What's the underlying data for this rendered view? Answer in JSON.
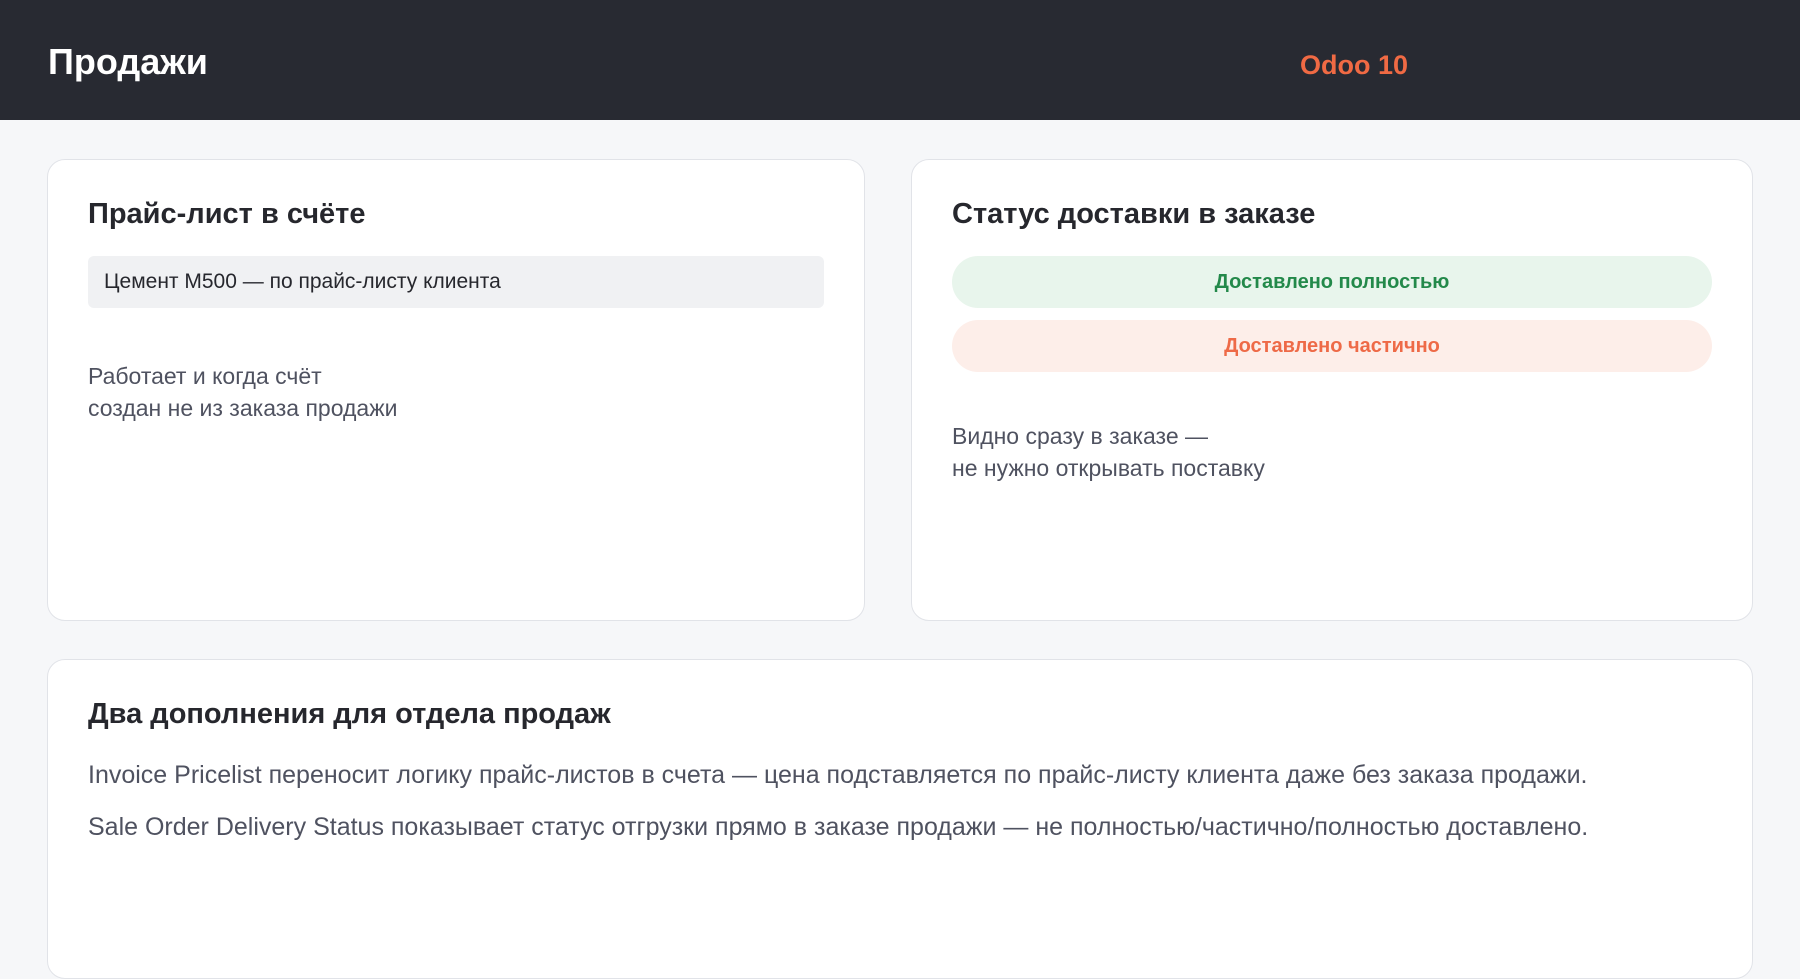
{
  "header": {
    "title": "Продажи",
    "version": "Odoo 10"
  },
  "invoice_card": {
    "title": "Прайс-лист в счёте",
    "field_value": "Цемент М500 — по прайс-листу клиента",
    "note_lines": [
      "Работает и когда счёт",
      "создан не из заказа продажи"
    ]
  },
  "delivery_card": {
    "title": "Статус доставки в заказе",
    "status_full": "Доставлено полностью",
    "status_partial": "Доставлено частично",
    "note_lines": [
      "Видно сразу в заказе —",
      "не нужно открывать поставку"
    ]
  },
  "summary_card": {
    "title": "Два дополнения для отдела продаж",
    "lines": [
      "Invoice Pricelist переносит логику прайс-листов в счета — цена подставляется по прайс-листу клиента даже без заказа продажи.",
      "Sale Order Delivery Status показывает статус отгрузки прямо в заказе продажи — не полностью/частично/полностью доставлено."
    ]
  },
  "colors": {
    "topbar": "#282a32",
    "accent": "#f06a44",
    "success_text": "#23894a",
    "success_bg": "#e8f5ec",
    "partial_text": "#ee6a47",
    "partial_bg": "#fdeee9"
  }
}
